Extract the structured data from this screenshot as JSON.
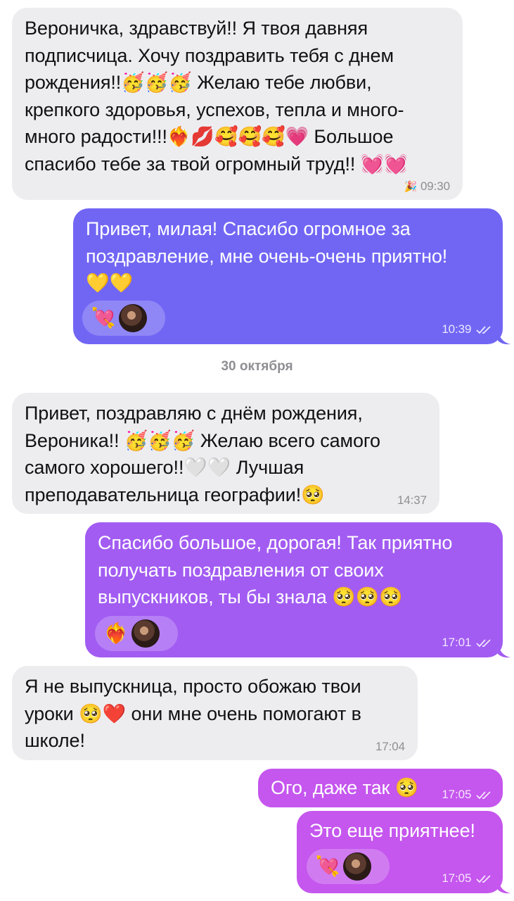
{
  "date_separator": "30 октября",
  "colors": {
    "incoming_bubble": "#ededf0",
    "out_blue": "#7166f4",
    "out_violet": "#a25cf2",
    "out_magenta": "#c556ee"
  },
  "messages": [
    {
      "direction": "incoming",
      "text": "Вероничка, здравствуй!! Я твоя давняя\nподписчица. Хочу поздравить тебя с днем\nрождения!!🥳🥳🥳 Желаю тебе любви,\nкрепкого здоровья, успехов, тепла и много-\nмного радости!!!❤️‍🔥💋🥰🥰🥰💗 Большое\nспасибо тебе за твой огромный труд!! 💓💓",
      "time": "09:30",
      "time_prefix_icon": "party-popper-icon",
      "time_prefix": "🎉"
    },
    {
      "direction": "outgoing",
      "text": "Привет, милая! Спасибо огромное за\nпоздравление, мне очень-очень приятно!\n💛💛",
      "time": "10:39",
      "read": true,
      "reactions": [
        {
          "emoji": "💘",
          "icon": "heart-arrow-icon"
        },
        {
          "type": "avatar"
        }
      ]
    },
    {
      "direction": "incoming",
      "text": "Привет, поздравляю с днём рождения,\nВероника!! 🥳🥳🥳 Желаю всего самого\nсамого хорошего!!🤍🤍 Лучшая\nпреподавательница географии!🥺",
      "time": "14:37"
    },
    {
      "direction": "outgoing",
      "text": "Спасибо большое, дорогая! Так приятно\nполучать поздравления от своих\nвыпускников, ты бы знала 🥺🥺🥺",
      "time": "17:01",
      "read": true,
      "reactions": [
        {
          "emoji": "❤️‍🔥",
          "icon": "heart-on-fire-icon"
        },
        {
          "type": "avatar"
        }
      ]
    },
    {
      "direction": "incoming",
      "text": "Я не выпускница, просто обожаю твои\nуроки 🥺❤️ они мне очень помогают в\nшколе!",
      "time": "17:04"
    },
    {
      "direction": "outgoing",
      "text": "Ого, даже так 🥺",
      "time": "17:05",
      "read": true
    },
    {
      "direction": "outgoing",
      "text": "Это еще приятнее!",
      "time": "17:05",
      "read": true,
      "reactions": [
        {
          "emoji": "💘",
          "icon": "heart-arrow-icon"
        },
        {
          "type": "avatar"
        }
      ]
    }
  ]
}
